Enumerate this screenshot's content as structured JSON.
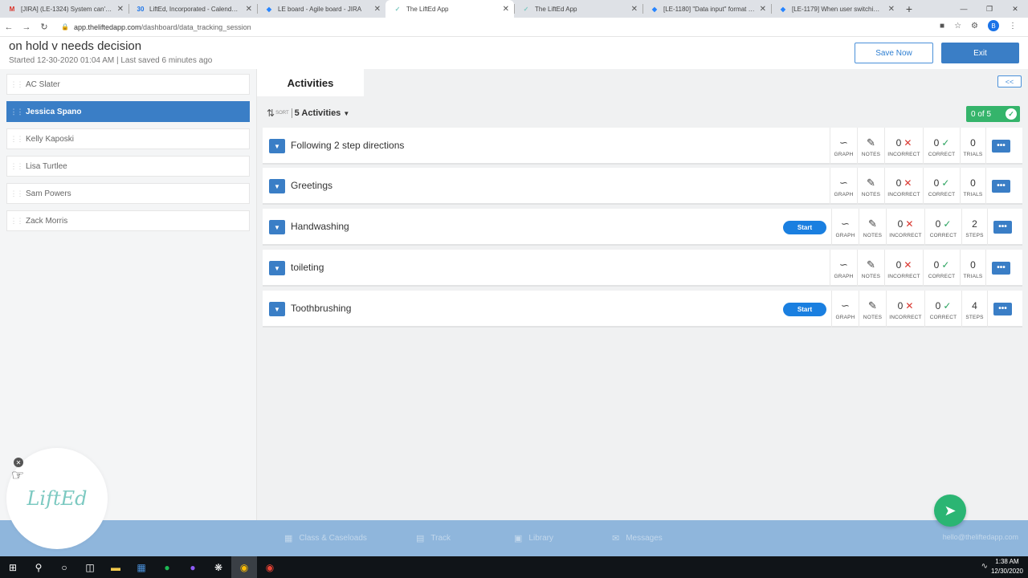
{
  "browser": {
    "tabs": [
      {
        "title": "[JIRA] (LE-1324) System can't sav",
        "favicon": "M",
        "favicon_color": "#d93025",
        "active": false
      },
      {
        "title": "LiftEd, Incorporated - Calendar -",
        "favicon": "30",
        "favicon_color": "#1a73e8",
        "active": false
      },
      {
        "title": "LE board - Agile board - JIRA",
        "favicon": "◆",
        "favicon_color": "#2684ff",
        "active": false
      },
      {
        "title": "The LiftEd App",
        "favicon": "✓",
        "favicon_color": "#7cc9c1",
        "active": true
      },
      {
        "title": "The LiftEd App",
        "favicon": "✓",
        "favicon_color": "#7cc9c1",
        "active": false
      },
      {
        "title": "[LE-1180] \"Data input\" format au",
        "favicon": "◆",
        "favicon_color": "#2684ff",
        "active": false
      },
      {
        "title": "[LE-1179] When user switching \"I",
        "favicon": "◆",
        "favicon_color": "#2684ff",
        "active": false
      }
    ],
    "new_tab": "+",
    "url_domain": "app.theliftedapp.com",
    "url_path": "/dashboard/data_tracking_session",
    "profile_initial": "B"
  },
  "header": {
    "title": "on hold v needs decision",
    "subtitle": "Started 12-30-2020 01:04 AM | Last saved 6 minutes ago",
    "save_label": "Save Now",
    "exit_label": "Exit"
  },
  "students": [
    {
      "name": "AC Slater",
      "active": false
    },
    {
      "name": "Jessica Spano",
      "active": true
    },
    {
      "name": "Kelly Kaposki",
      "active": false
    },
    {
      "name": "Lisa Turtlee",
      "active": false
    },
    {
      "name": "Sam Powers",
      "active": false
    },
    {
      "name": "Zack Morris",
      "active": false
    }
  ],
  "main": {
    "tab_label": "Activities",
    "collapse_label": "<<",
    "sort_label": "SORT",
    "activity_count": "5 Activities",
    "progress": "0 of 5",
    "start_label": "Start",
    "labels": {
      "graph": "GRAPH",
      "notes": "NOTES",
      "incorrect": "INCORRECT",
      "correct": "CORRECT"
    },
    "activities": [
      {
        "name": "Following 2 step directions",
        "incorrect": "0",
        "correct": "0",
        "count": "0",
        "count_label": "TRIALS",
        "has_start": false
      },
      {
        "name": "Greetings",
        "incorrect": "0",
        "correct": "0",
        "count": "0",
        "count_label": "TRIALS",
        "has_start": false
      },
      {
        "name": "Handwashing",
        "incorrect": "0",
        "correct": "0",
        "count": "2",
        "count_label": "STEPS",
        "has_start": true
      },
      {
        "name": "toileting",
        "incorrect": "0",
        "correct": "0",
        "count": "0",
        "count_label": "TRIALS",
        "has_start": false
      },
      {
        "name": "Toothbrushing",
        "incorrect": "0",
        "correct": "0",
        "count": "4",
        "count_label": "STEPS",
        "has_start": true
      }
    ]
  },
  "footer": {
    "items": [
      "Class & Caseloads",
      "Track",
      "Library",
      "Messages"
    ],
    "email": "hello@theliftedapp.com"
  },
  "logo_text": "LiftEd",
  "taskbar": {
    "time": "1:38 AM",
    "date": "12/30/2020"
  },
  "colors": {
    "primary": "#3a7ec6",
    "success": "#35b46b",
    "error": "#d9352e",
    "footer": "#8fb6dc"
  }
}
